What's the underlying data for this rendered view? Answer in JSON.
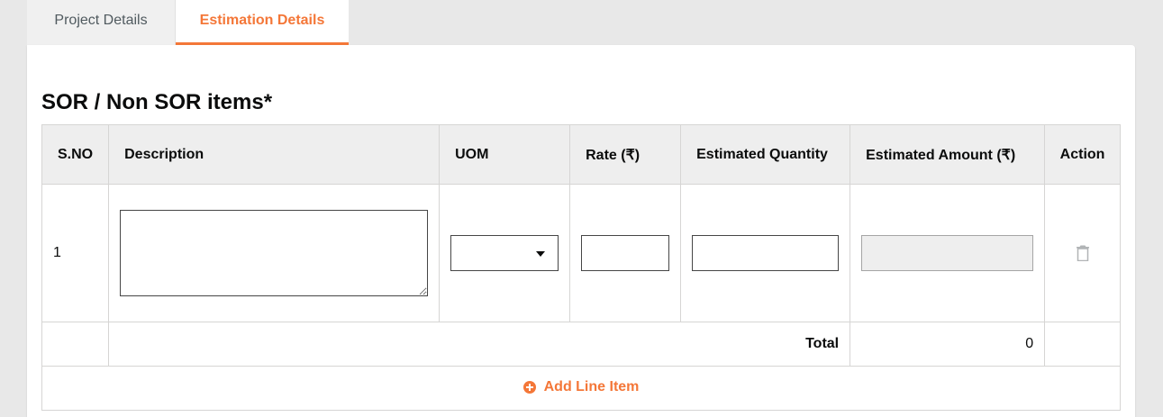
{
  "tabs": [
    {
      "label": "Project Details",
      "active": false
    },
    {
      "label": "Estimation Details",
      "active": true
    }
  ],
  "section": {
    "title": "SOR / Non SOR items*"
  },
  "table": {
    "headers": {
      "sno": "S.NO",
      "description": "Description",
      "uom": "UOM",
      "rate": "Rate (₹)",
      "estimated_quantity": "Estimated Quantity",
      "estimated_amount": "Estimated Amount (₹)",
      "action": "Action"
    },
    "rows": [
      {
        "sno": "1",
        "description": "",
        "uom": "",
        "rate": "",
        "estimated_quantity": "",
        "estimated_amount": ""
      }
    ],
    "total_label": "Total",
    "total_value": "0",
    "add_line_label": "Add Line Item"
  },
  "colors": {
    "accent": "#f47738",
    "header_bg": "#eeeeee",
    "page_bg": "#e8e8e8"
  },
  "icons": {
    "delete": "trash-icon",
    "add": "plus-circle-icon",
    "dropdown": "caret-down-icon"
  }
}
